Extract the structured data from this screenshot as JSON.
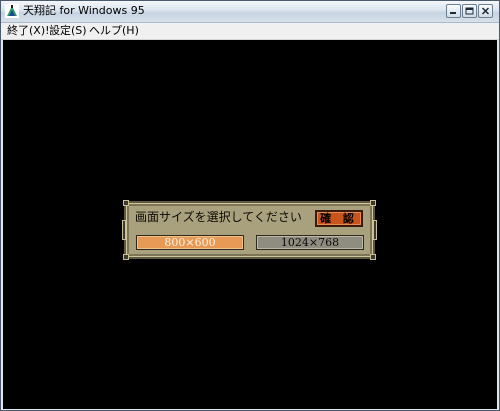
{
  "window": {
    "title": "天翔記 for Windows 95",
    "controls": {
      "minimize": "minimize-icon",
      "maximize": "maximize-icon",
      "close": "close-icon"
    }
  },
  "menu": {
    "items": [
      {
        "label": "終了(X)!"
      },
      {
        "label": "設定(S)"
      },
      {
        "label": "ヘルプ(H)"
      }
    ]
  },
  "dialog": {
    "prompt": "画面サイズを選択してください",
    "confirm_label": "確 認",
    "options": [
      {
        "label": "800×600",
        "selected": true
      },
      {
        "label": "1024×768",
        "selected": false
      }
    ]
  },
  "colors": {
    "client_background": "#000000",
    "dialog_background": "#a9a07d",
    "confirm_button": "#c9541c",
    "selected_option": "#e69a55",
    "unselected_option": "#8f8c80"
  }
}
